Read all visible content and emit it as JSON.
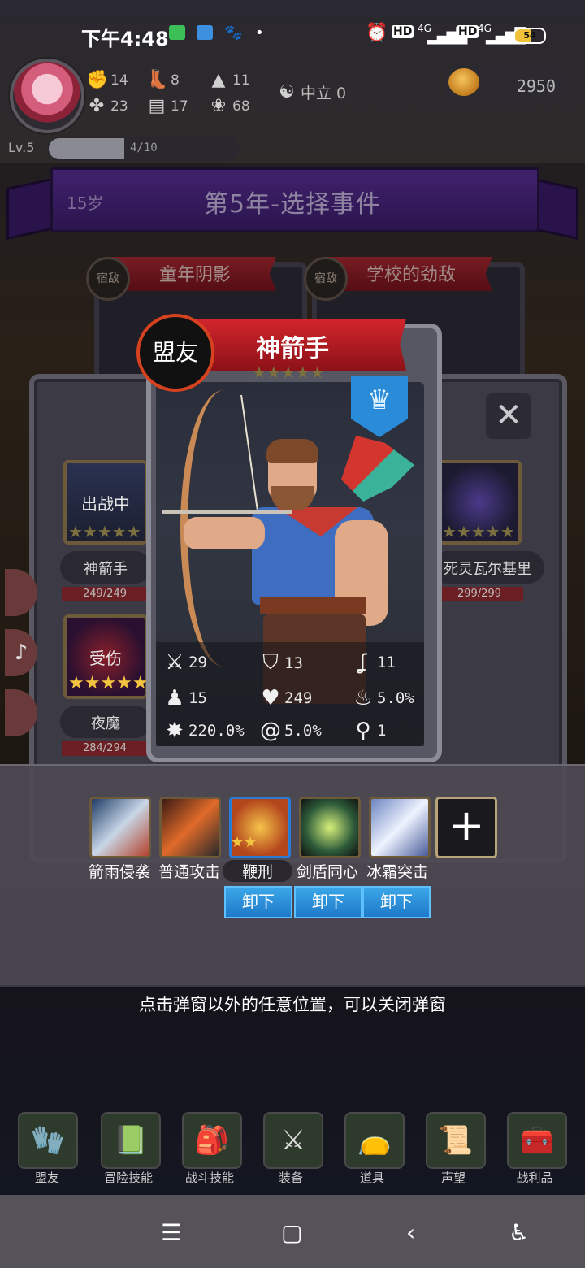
{
  "status": {
    "time": "下午4:48",
    "network": "4G",
    "battery": "54"
  },
  "header": {
    "stats": [
      {
        "icon": "fist-icon",
        "value": "14"
      },
      {
        "icon": "boot-icon",
        "value": "8"
      },
      {
        "icon": "wizard-hat-icon",
        "value": "11"
      },
      {
        "icon": "clover-icon",
        "value": "23"
      },
      {
        "icon": "book-icon",
        "value": "17"
      },
      {
        "icon": "lotus-icon",
        "value": "68"
      }
    ],
    "alignment": "中立 0",
    "gold": "2950",
    "level": "Lv.5",
    "xp": "4/10",
    "xp_fraction": 0.4
  },
  "banner": {
    "age": "15岁",
    "title": "第5年-选择事件"
  },
  "events": [
    {
      "tag": "宿敌",
      "title": "童年阴影"
    },
    {
      "tag": "宿敌",
      "title": "学校的劲敌"
    }
  ],
  "roster": [
    {
      "name": "神箭手",
      "hp": "249/249",
      "overlay": "出战中"
    },
    {
      "name": "夜魔",
      "hp": "284/294",
      "overlay": "受伤"
    },
    {
      "name": "死灵瓦尔基里",
      "hp": "299/299"
    }
  ],
  "card": {
    "badge": "盟友",
    "name": "神箭手",
    "stars": "★★★★★",
    "class_icon": "crown-icon",
    "stats": [
      {
        "icon": "sword-icon",
        "value": "29"
      },
      {
        "icon": "shield-icon",
        "value": "13"
      },
      {
        "icon": "hook-icon",
        "value": "11"
      },
      {
        "icon": "hooded-figure-icon",
        "value": "15"
      },
      {
        "icon": "heart-icon",
        "value": "249"
      },
      {
        "icon": "flame-icon",
        "value": "5.0%"
      },
      {
        "icon": "burst-icon",
        "value": "220.0%"
      },
      {
        "icon": "whirlwind-icon",
        "value": "5.0%"
      },
      {
        "icon": "boot-icon",
        "value": "1"
      }
    ]
  },
  "skills": [
    {
      "name": "箭雨侵袭",
      "color": "#3b6ea8"
    },
    {
      "name": "普通攻击",
      "color": "#8a3b1f"
    },
    {
      "name": "鞭刑",
      "color": "#c46a1c",
      "stars": "★★"
    },
    {
      "name": "剑盾同心",
      "color": "#2d5b3a"
    },
    {
      "name": "冰霜突击",
      "color": "#7d98c9"
    }
  ],
  "unequip_label": "卸下",
  "hint": "点击弹窗以外的任意位置，可以关闭弹窗",
  "nav": [
    {
      "label": "盟友",
      "icon": "gauntlet-icon"
    },
    {
      "label": "冒险技能",
      "icon": "book-icon"
    },
    {
      "label": "战斗技能",
      "icon": "backpack-icon"
    },
    {
      "label": "装备",
      "icon": "crossed-swords-icon"
    },
    {
      "label": "道具",
      "icon": "pouch-icon"
    },
    {
      "label": "声望",
      "icon": "scroll-icon"
    },
    {
      "label": "战利品",
      "icon": "treasure-chest-icon"
    }
  ]
}
